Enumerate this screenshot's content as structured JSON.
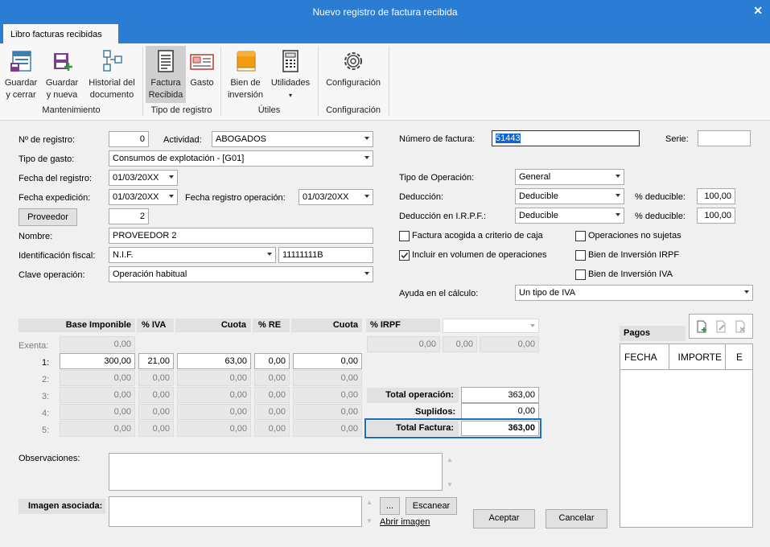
{
  "window": {
    "title": "Nuevo registro de factura recibida",
    "close": "✕"
  },
  "tab": "Libro facturas recibidas",
  "ribbon": {
    "save_close": [
      "Guardar",
      "y cerrar"
    ],
    "save_new": [
      "Guardar",
      "y nueva"
    ],
    "history": [
      "Historial del",
      "documento"
    ],
    "group_maint": "Mantenimiento",
    "factura_recibida": [
      "Factura",
      "Recibida"
    ],
    "gasto": "Gasto",
    "group_tipo": "Tipo de registro",
    "bien_inversion": [
      "Bien de",
      "inversión"
    ],
    "utilidades": "Utilidades",
    "group_utiles": "Útiles",
    "configuracion": "Configuración",
    "group_config": "Configuración"
  },
  "form": {
    "n_registro_label": "Nº de registro:",
    "n_registro": "0",
    "actividad_label": "Actividad:",
    "actividad": "ABOGADOS",
    "tipo_gasto_label": "Tipo de gasto:",
    "tipo_gasto": "Consumos de explotación - [G01]",
    "fecha_registro_label": "Fecha del registro:",
    "fecha_registro": "01/03/20XX",
    "fecha_expedicion_label": "Fecha expedición:",
    "fecha_expedicion": "01/03/20XX",
    "fecha_reg_op_label": "Fecha registro operación:",
    "fecha_reg_op": "01/03/20XX",
    "proveedor_btn": "Proveedor",
    "proveedor": "2",
    "nombre_label": "Nombre:",
    "nombre": "PROVEEDOR 2",
    "id_fiscal_label": "Identificación fiscal:",
    "id_fiscal_tipo": "N.I.F.",
    "id_fiscal": "11111111B",
    "clave_label": "Clave operación:",
    "clave": "Operación habitual",
    "num_factura_label": "Número de factura:",
    "num_factura": "51443",
    "serie_label": "Serie:",
    "serie": "",
    "tipo_op_label": "Tipo de Operación:",
    "tipo_op": "General",
    "deduccion_label": "Deducción:",
    "deduccion": "Deducible",
    "pct_deducible_label": "% deducible:",
    "pct_deducible": "100,00",
    "deduccion_irpf_label": "Deducción en I.R.P.F.:",
    "deduccion_irpf": "Deducible",
    "pct_deducible2": "100,00",
    "chk_criterio_caja": "Factura acogida a criterio de caja",
    "chk_no_sujetas": "Operaciones no sujetas",
    "chk_volumen": "Incluir en  volumen de operaciones",
    "chk_bien_irpf": "Bien de Inversión IRPF",
    "chk_bien_iva": "Bien de Inversión IVA",
    "ayuda_label": "Ayuda en el cálculo:",
    "ayuda": "Un tipo de IVA"
  },
  "tax": {
    "headers": {
      "base": "Base Imponible",
      "iva": "% IVA",
      "cuota": "Cuota",
      "re": "% RE",
      "cuota_re": "Cuota",
      "irpf": "% IRPF"
    },
    "exenta_label": "Exenta:",
    "exenta": "0,00",
    "rows": [
      {
        "label": "1:",
        "base": "300,00",
        "iva": "21,00",
        "cuota": "63,00",
        "re": "0,00",
        "cuota_re": "0,00"
      },
      {
        "label": "2:",
        "base": "0,00",
        "iva": "0,00",
        "cuota": "0,00",
        "re": "0,00",
        "cuota_re": "0,00"
      },
      {
        "label": "3:",
        "base": "0,00",
        "iva": "0,00",
        "cuota": "0,00",
        "re": "0,00",
        "cuota_re": "0,00"
      },
      {
        "label": "4:",
        "base": "0,00",
        "iva": "0,00",
        "cuota": "0,00",
        "re": "0,00",
        "cuota_re": "0,00"
      },
      {
        "label": "5:",
        "base": "0,00",
        "iva": "0,00",
        "cuota": "0,00",
        "re": "0,00",
        "cuota_re": "0,00"
      }
    ],
    "irpf_vals": [
      "0,00",
      "0,00",
      "0,00"
    ],
    "total_op_label": "Total operación:",
    "total_op": "363,00",
    "suplidos_label": "Suplidos:",
    "suplidos": "0,00",
    "total_factura_label": "Total Factura:",
    "total_factura": "363,00"
  },
  "pagos": {
    "title": "Pagos",
    "col_fecha": "FECHA",
    "col_importe": "IMPORTE",
    "col_e": "E"
  },
  "bottom": {
    "observaciones_label": "Observaciones:",
    "imagen_label": "Imagen asociada:",
    "browse": "...",
    "escanear": "Escanear",
    "abrir": "Abrir imagen",
    "aceptar": "Aceptar",
    "cancelar": "Cancelar"
  }
}
